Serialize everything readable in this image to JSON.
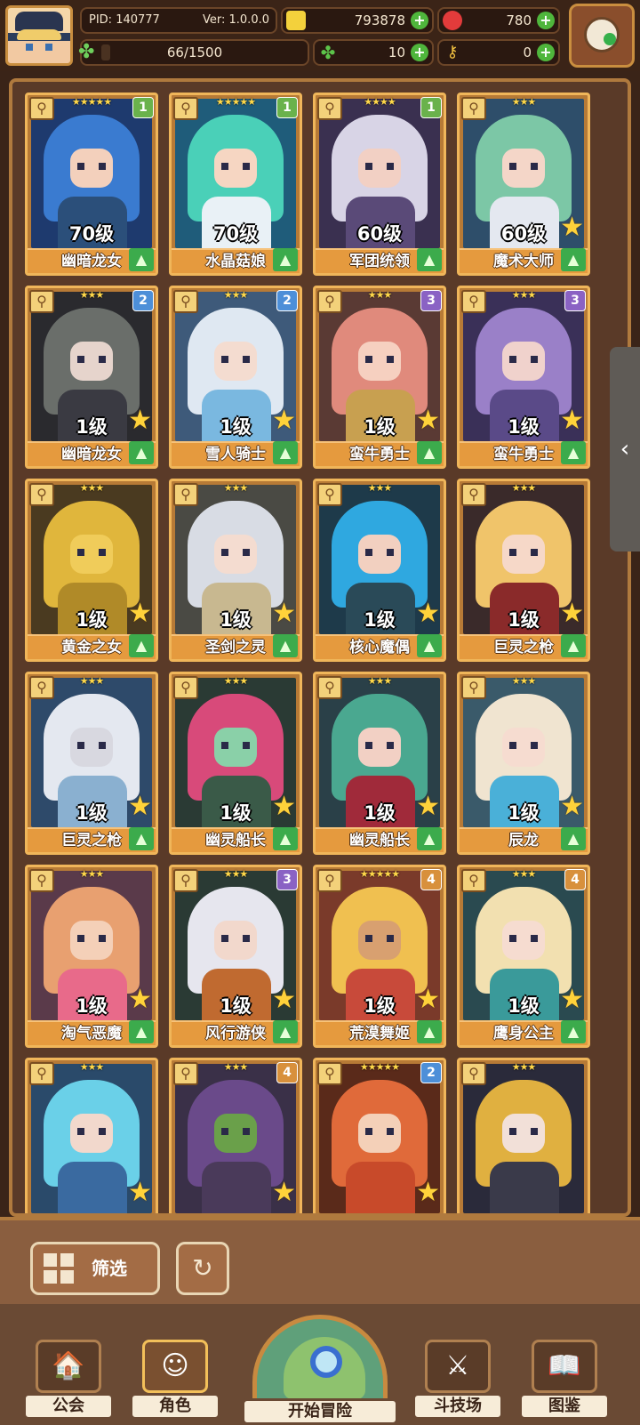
{
  "header": {
    "pid": "PID: 140777",
    "version": "Ver: 1.0.0.0",
    "exp_current": 66,
    "exp_max": 1500,
    "exp_text": "66/1500",
    "gold": "793878",
    "ruby": "780",
    "clover": "10",
    "key": "0",
    "colors": {
      "gold": "#f3d13c",
      "ruby": "#e23b3b",
      "clover": "#5cc44a",
      "key": "#f0c040"
    }
  },
  "cards": [
    {
      "name": "幽暗龙女",
      "level": "70级",
      "stars": "★★★★★",
      "badge": "1",
      "badge_color": "green",
      "has_big_star": false,
      "palette": [
        "#1e3a6e",
        "#3a7bd0",
        "#f3d0bc",
        "#2b4f7a"
      ]
    },
    {
      "name": "水晶菇娘",
      "level": "70级",
      "stars": "★★★★★",
      "badge": "1",
      "badge_color": "green",
      "has_big_star": false,
      "palette": [
        "#1f5c7a",
        "#4ad0b8",
        "#f6d6c2",
        "#e9f1f6"
      ]
    },
    {
      "name": "军团统领",
      "level": "60级",
      "stars": "★★★★",
      "badge": "1",
      "badge_color": "green",
      "has_big_star": false,
      "palette": [
        "#3a3050",
        "#d8d4e6",
        "#f2d0c4",
        "#5a4a78"
      ]
    },
    {
      "name": "魔术大师",
      "level": "60级",
      "stars": "★★★",
      "badge": "",
      "badge_color": "",
      "has_big_star": true,
      "palette": [
        "#2e4e6a",
        "#7cc7a6",
        "#f4d6c8",
        "#e4e8f0"
      ]
    },
    {
      "name": "幽暗龙女",
      "level": "1级",
      "stars": "★★★",
      "badge": "2",
      "badge_color": "blue",
      "has_big_star": true,
      "palette": [
        "#2a2a2e",
        "#6a6e6a",
        "#e6d4cc",
        "#3a3a42"
      ]
    },
    {
      "name": "雪人骑士",
      "level": "1级",
      "stars": "★★★",
      "badge": "2",
      "badge_color": "blue",
      "has_big_star": true,
      "palette": [
        "#3e5a7a",
        "#dfe8f2",
        "#f4dcd0",
        "#7ab8e0"
      ]
    },
    {
      "name": "蛮牛勇士",
      "level": "1级",
      "stars": "★★★",
      "badge": "3",
      "badge_color": "purple",
      "has_big_star": true,
      "palette": [
        "#5a3a34",
        "#e08a7c",
        "#f6d0c0",
        "#c8a050"
      ]
    },
    {
      "name": "蛮牛勇士",
      "level": "1级",
      "stars": "★★★",
      "badge": "3",
      "badge_color": "purple",
      "has_big_star": true,
      "palette": [
        "#3a3058",
        "#9a80c8",
        "#f0d2cc",
        "#5a4a88"
      ]
    },
    {
      "name": "黄金之女",
      "level": "1级",
      "stars": "★★★",
      "badge": "",
      "badge_color": "",
      "has_big_star": true,
      "palette": [
        "#4a3a20",
        "#e0b63c",
        "#f0cc5a",
        "#b08a28"
      ]
    },
    {
      "name": "圣剑之灵",
      "level": "1级",
      "stars": "★★★",
      "badge": "",
      "badge_color": "",
      "has_big_star": true,
      "palette": [
        "#4a4a44",
        "#d8dce4",
        "#f4dcd0",
        "#c8b890"
      ]
    },
    {
      "name": "核心魔偶",
      "level": "1级",
      "stars": "★★★",
      "badge": "",
      "badge_color": "",
      "has_big_star": true,
      "palette": [
        "#1e3a4a",
        "#2fa8e0",
        "#f2d0c0",
        "#2a4a58"
      ]
    },
    {
      "name": "巨灵之枪",
      "level": "1级",
      "stars": "★★★",
      "badge": "",
      "badge_color": "",
      "has_big_star": true,
      "palette": [
        "#3a2a2a",
        "#f0c46a",
        "#f6d8c8",
        "#8a2a2a"
      ]
    },
    {
      "name": "巨灵之枪",
      "level": "1级",
      "stars": "★★★",
      "badge": "",
      "badge_color": "",
      "has_big_star": true,
      "palette": [
        "#2e4a6a",
        "#e4e8f0",
        "#d8d8e0",
        "#8ab0d0"
      ]
    },
    {
      "name": "幽灵船长",
      "level": "1级",
      "stars": "★★★",
      "badge": "",
      "badge_color": "",
      "has_big_star": true,
      "palette": [
        "#2a3a34",
        "#d84a7a",
        "#8ad0a8",
        "#3a5a48"
      ]
    },
    {
      "name": "幽灵船长",
      "level": "1级",
      "stars": "★★★",
      "badge": "",
      "badge_color": "",
      "has_big_star": true,
      "palette": [
        "#2a4048",
        "#4aa890",
        "#f2d0c4",
        "#a02a3a"
      ]
    },
    {
      "name": "辰龙",
      "level": "1级",
      "stars": "★★★",
      "badge": "",
      "badge_color": "",
      "has_big_star": true,
      "palette": [
        "#3a5a6a",
        "#f0e4d0",
        "#f6dcd0",
        "#4ab0d8"
      ]
    },
    {
      "name": "淘气恶魔",
      "level": "1级",
      "stars": "★★★",
      "badge": "",
      "badge_color": "",
      "has_big_star": true,
      "palette": [
        "#5a3a4a",
        "#e8a070",
        "#f4d0b8",
        "#e86a8a"
      ]
    },
    {
      "name": "风行游侠",
      "level": "1级",
      "stars": "★★★",
      "badge": "3",
      "badge_color": "purple",
      "has_big_star": true,
      "palette": [
        "#2a3a34",
        "#e6e6ee",
        "#f2d8cc",
        "#c06a30"
      ]
    },
    {
      "name": "荒漠舞姬",
      "level": "1级",
      "stars": "★★★★★",
      "badge": "4",
      "badge_color": "orange",
      "has_big_star": true,
      "palette": [
        "#7a3a2a",
        "#f0c050",
        "#d8a070",
        "#c84a3a"
      ]
    },
    {
      "name": "鹰身公主",
      "level": "1级",
      "stars": "★★★",
      "badge": "4",
      "badge_color": "orange",
      "has_big_star": true,
      "palette": [
        "#2a4a50",
        "#f2e0b0",
        "#f6dcd0",
        "#3a9a9a"
      ]
    },
    {
      "name": "",
      "level": "",
      "stars": "★★★",
      "badge": "",
      "badge_color": "",
      "has_big_star": true,
      "palette": [
        "#2a4a6a",
        "#6ad0e8",
        "#f2d8cc",
        "#3a6aa0"
      ]
    },
    {
      "name": "",
      "level": "",
      "stars": "★★★",
      "badge": "4",
      "badge_color": "orange",
      "has_big_star": true,
      "palette": [
        "#3a3048",
        "#6a4a8a",
        "#6aa04a",
        "#4a3a5a"
      ]
    },
    {
      "name": "",
      "level": "",
      "stars": "★★★★★",
      "badge": "2",
      "badge_color": "blue",
      "has_big_star": true,
      "palette": [
        "#5a2a1a",
        "#e06a3a",
        "#f4d0b8",
        "#c84a2a"
      ]
    },
    {
      "name": "",
      "level": "",
      "stars": "★★★",
      "badge": "",
      "badge_color": "",
      "has_big_star": false,
      "palette": [
        "#2a2a3a",
        "#e0b040",
        "#f2e0d8",
        "#3a3a4a"
      ]
    }
  ],
  "filter": {
    "label": "筛选"
  },
  "nav": {
    "guild": "公会",
    "character": "角色",
    "adventure": "开始冒险",
    "arena": "斗技场",
    "codex": "图鉴"
  }
}
